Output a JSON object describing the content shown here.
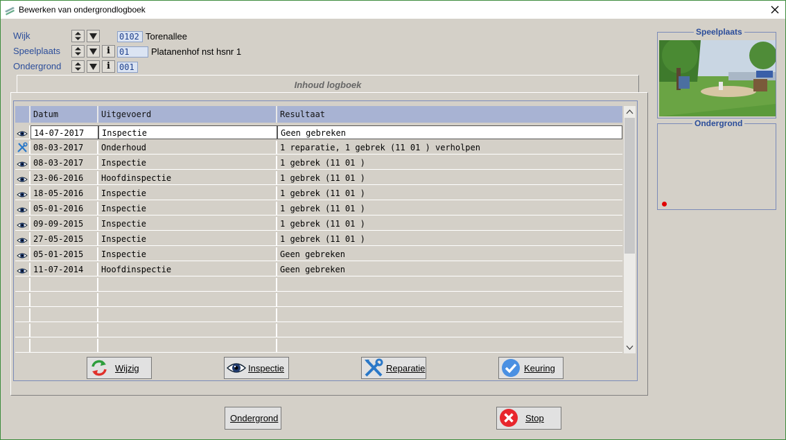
{
  "window": {
    "title": "Bewerken van ondergrondlogboek"
  },
  "fields": {
    "wijk": {
      "label": "Wijk",
      "code": "0102",
      "name": "Torenallee"
    },
    "speelplaats": {
      "label": "Speelplaats",
      "code": "01",
      "name": "Platanenhof nst hsnr 1"
    },
    "ondergrond": {
      "label": "Ondergrond",
      "code": "001"
    }
  },
  "tab": {
    "title": "Inhoud logboek"
  },
  "table": {
    "columns": [
      "Datum",
      "Uitgevoerd",
      "Resultaat"
    ],
    "rows": [
      {
        "icon": "eye-icon",
        "datum": "14-07-2017",
        "uitgevoerd": "Inspectie",
        "resultaat": "Geen gebreken"
      },
      {
        "icon": "wrench-icon",
        "datum": "08-03-2017",
        "uitgevoerd": "Onderhoud",
        "resultaat": "1 reparatie, 1 gebrek (11 01 ) verholpen"
      },
      {
        "icon": "eye-icon",
        "datum": "08-03-2017",
        "uitgevoerd": "Inspectie",
        "resultaat": "1 gebrek (11 01 )"
      },
      {
        "icon": "eye-icon",
        "datum": "23-06-2016",
        "uitgevoerd": "Hoofdinspectie",
        "resultaat": "1 gebrek (11 01 )"
      },
      {
        "icon": "eye-icon",
        "datum": "18-05-2016",
        "uitgevoerd": "Inspectie",
        "resultaat": "1 gebrek (11 01 )"
      },
      {
        "icon": "eye-icon",
        "datum": "05-01-2016",
        "uitgevoerd": "Inspectie",
        "resultaat": "1 gebrek (11 01 )"
      },
      {
        "icon": "eye-icon",
        "datum": "09-09-2015",
        "uitgevoerd": "Inspectie",
        "resultaat": "1 gebrek (11 01 )"
      },
      {
        "icon": "eye-icon",
        "datum": "27-05-2015",
        "uitgevoerd": "Inspectie",
        "resultaat": "1 gebrek (11 01 )"
      },
      {
        "icon": "eye-icon",
        "datum": "05-01-2015",
        "uitgevoerd": "Inspectie",
        "resultaat": "Geen gebreken"
      },
      {
        "icon": "eye-icon",
        "datum": "11-07-2014",
        "uitgevoerd": "Hoofdinspectie",
        "resultaat": "Geen gebreken"
      }
    ],
    "empty_rows": 5
  },
  "actions": {
    "wijzig": "Wijzig",
    "inspectie": "Inspectie",
    "reparatie": "Reparatie",
    "keuring": "Keuring"
  },
  "footer": {
    "ondergrond": "Ondergrond",
    "stop": "Stop"
  },
  "side": {
    "speelplaats_title": "Speelplaats",
    "ondergrond_title": "Ondergrond"
  },
  "colors": {
    "label_blue": "#2b4d9a",
    "header_bg": "#a8b3d3",
    "code_bg": "#dbe4f3",
    "stop_red": "#e8262d",
    "keuring_blue": "#4a90e2"
  }
}
